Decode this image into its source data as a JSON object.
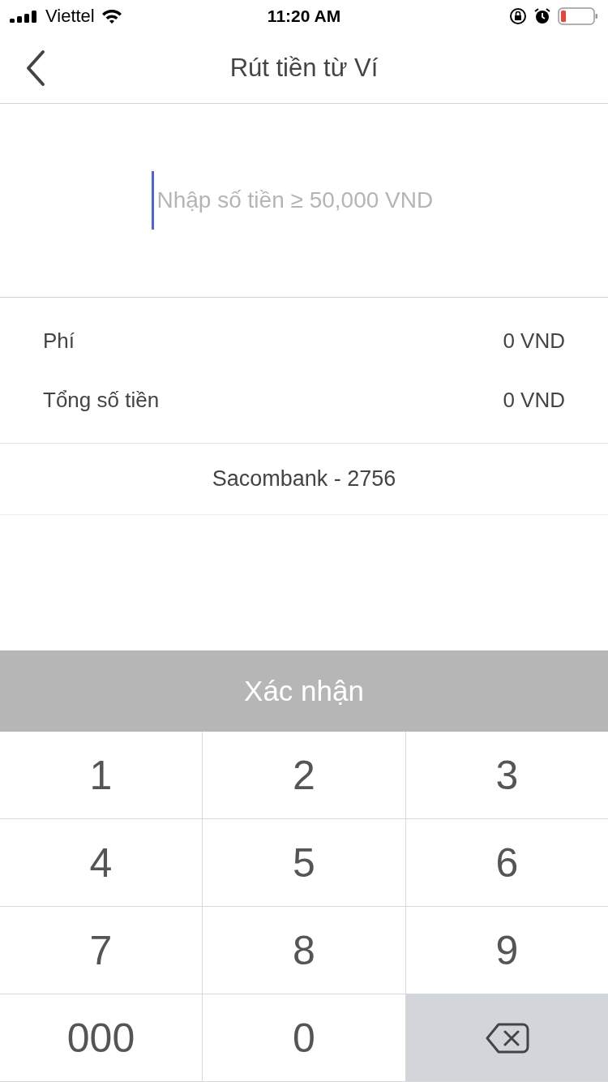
{
  "status_bar": {
    "carrier": "Viettel",
    "time": "11:20 AM"
  },
  "nav": {
    "title": "Rút tiền từ Ví"
  },
  "amount_field": {
    "placeholder": "Nhập số tiền ≥ 50,000 VND",
    "focused": true
  },
  "summary": [
    {
      "label": "Phí",
      "value": "0 VND"
    },
    {
      "label": "Tổng số tiền",
      "value": "0 VND"
    }
  ],
  "bank_account": "Sacombank - 2756",
  "confirm_button": {
    "label": "Xác nhận",
    "disabled": true
  },
  "keypad": [
    {
      "kind": "digit",
      "label": "1"
    },
    {
      "kind": "digit",
      "label": "2"
    },
    {
      "kind": "digit",
      "label": "3"
    },
    {
      "kind": "digit",
      "label": "4"
    },
    {
      "kind": "digit",
      "label": "5"
    },
    {
      "kind": "digit",
      "label": "6"
    },
    {
      "kind": "digit",
      "label": "7"
    },
    {
      "kind": "digit",
      "label": "8"
    },
    {
      "kind": "digit",
      "label": "9"
    },
    {
      "kind": "digit",
      "label": "000"
    },
    {
      "kind": "digit",
      "label": "0"
    },
    {
      "kind": "backspace"
    }
  ]
}
